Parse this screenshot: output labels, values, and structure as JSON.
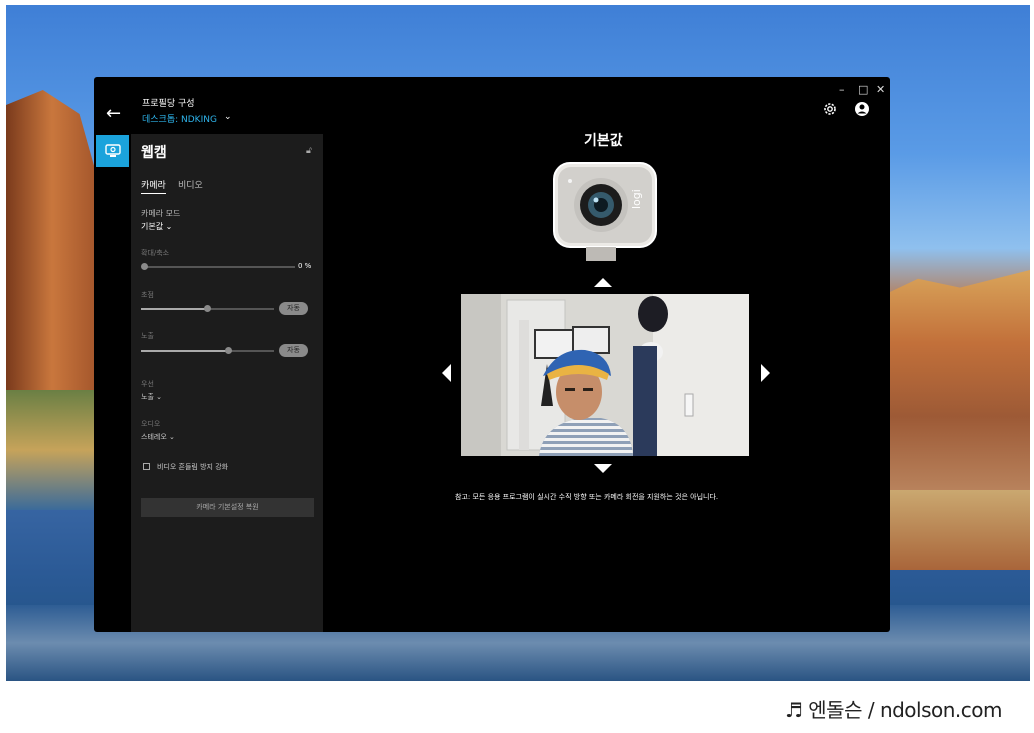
{
  "window": {
    "title": "프로필당 구성",
    "device": "데스크톱: NDKING"
  },
  "panel": {
    "title": "웹캠",
    "tabs": [
      {
        "label": "카메라",
        "active": true
      },
      {
        "label": "비디오",
        "active": false
      }
    ],
    "camera_mode": {
      "label": "카메라 모드",
      "value": "기본값"
    },
    "zoom": {
      "label": "확대/축소",
      "value": "0 %",
      "level": 0
    },
    "focus": {
      "label": "초점",
      "auto": "자동",
      "level": 0.5
    },
    "exposure": {
      "label": "노출",
      "auto": "자동",
      "level": 0.65
    },
    "priority": {
      "label": "우선",
      "value": "노출"
    },
    "audio": {
      "label": "오디오",
      "value": "스테레오"
    },
    "stabilize": {
      "label": "비디오 흔들림 방지 강화",
      "checked": false
    },
    "reset_label": "카메라 기본설정 복원"
  },
  "main": {
    "title": "기본값",
    "note": "참고: 모든 응용 프로그램이 실시간 수직 방향 또는 카메라 회전을 지원하는 것은 아닙니다."
  },
  "watermark": "♬ 엔돌슨 / ndolson.com",
  "colors": {
    "accent": "#1ba3dc",
    "window_bg": "#000000",
    "panel_bg": "#1c1c1c"
  }
}
